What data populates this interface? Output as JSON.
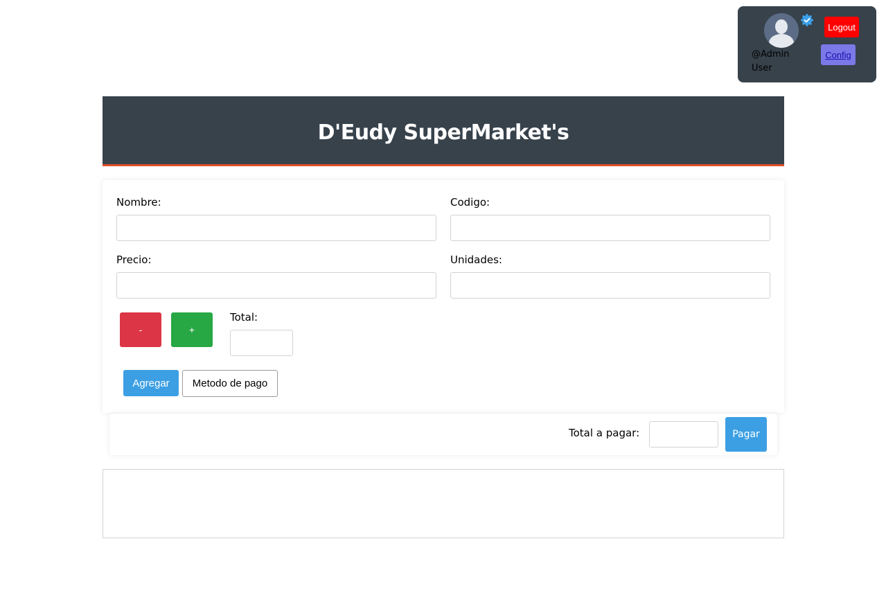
{
  "user_panel": {
    "username": "@Admin User",
    "logout_label": "Logout",
    "config_label": "Config",
    "verified_icon": "gear-check-icon",
    "avatar_icon": "user-silhouette-icon"
  },
  "header": {
    "title": "D'Eudy SuperMarket's"
  },
  "form": {
    "nombre_label": "Nombre:",
    "nombre_value": "",
    "codigo_label": "Codigo:",
    "codigo_value": "",
    "precio_label": "Precio:",
    "precio_value": "",
    "unidades_label": "Unidades:",
    "unidades_value": "",
    "minus_label": "-",
    "plus_label": "+",
    "total_label": "Total:",
    "total_value": "",
    "agregar_label": "Agregar",
    "metodo_label": "Metodo de pago"
  },
  "pay": {
    "total_label": "Total a pagar:",
    "total_value": "",
    "pagar_label": "Pagar"
  },
  "colors": {
    "header_bg": "#37424b",
    "header_border": "#e0502a",
    "logout": "#ff0000",
    "config": "#7b78e8",
    "minus": "#dc3545",
    "plus": "#28a745",
    "primary": "#3c9fe4"
  }
}
